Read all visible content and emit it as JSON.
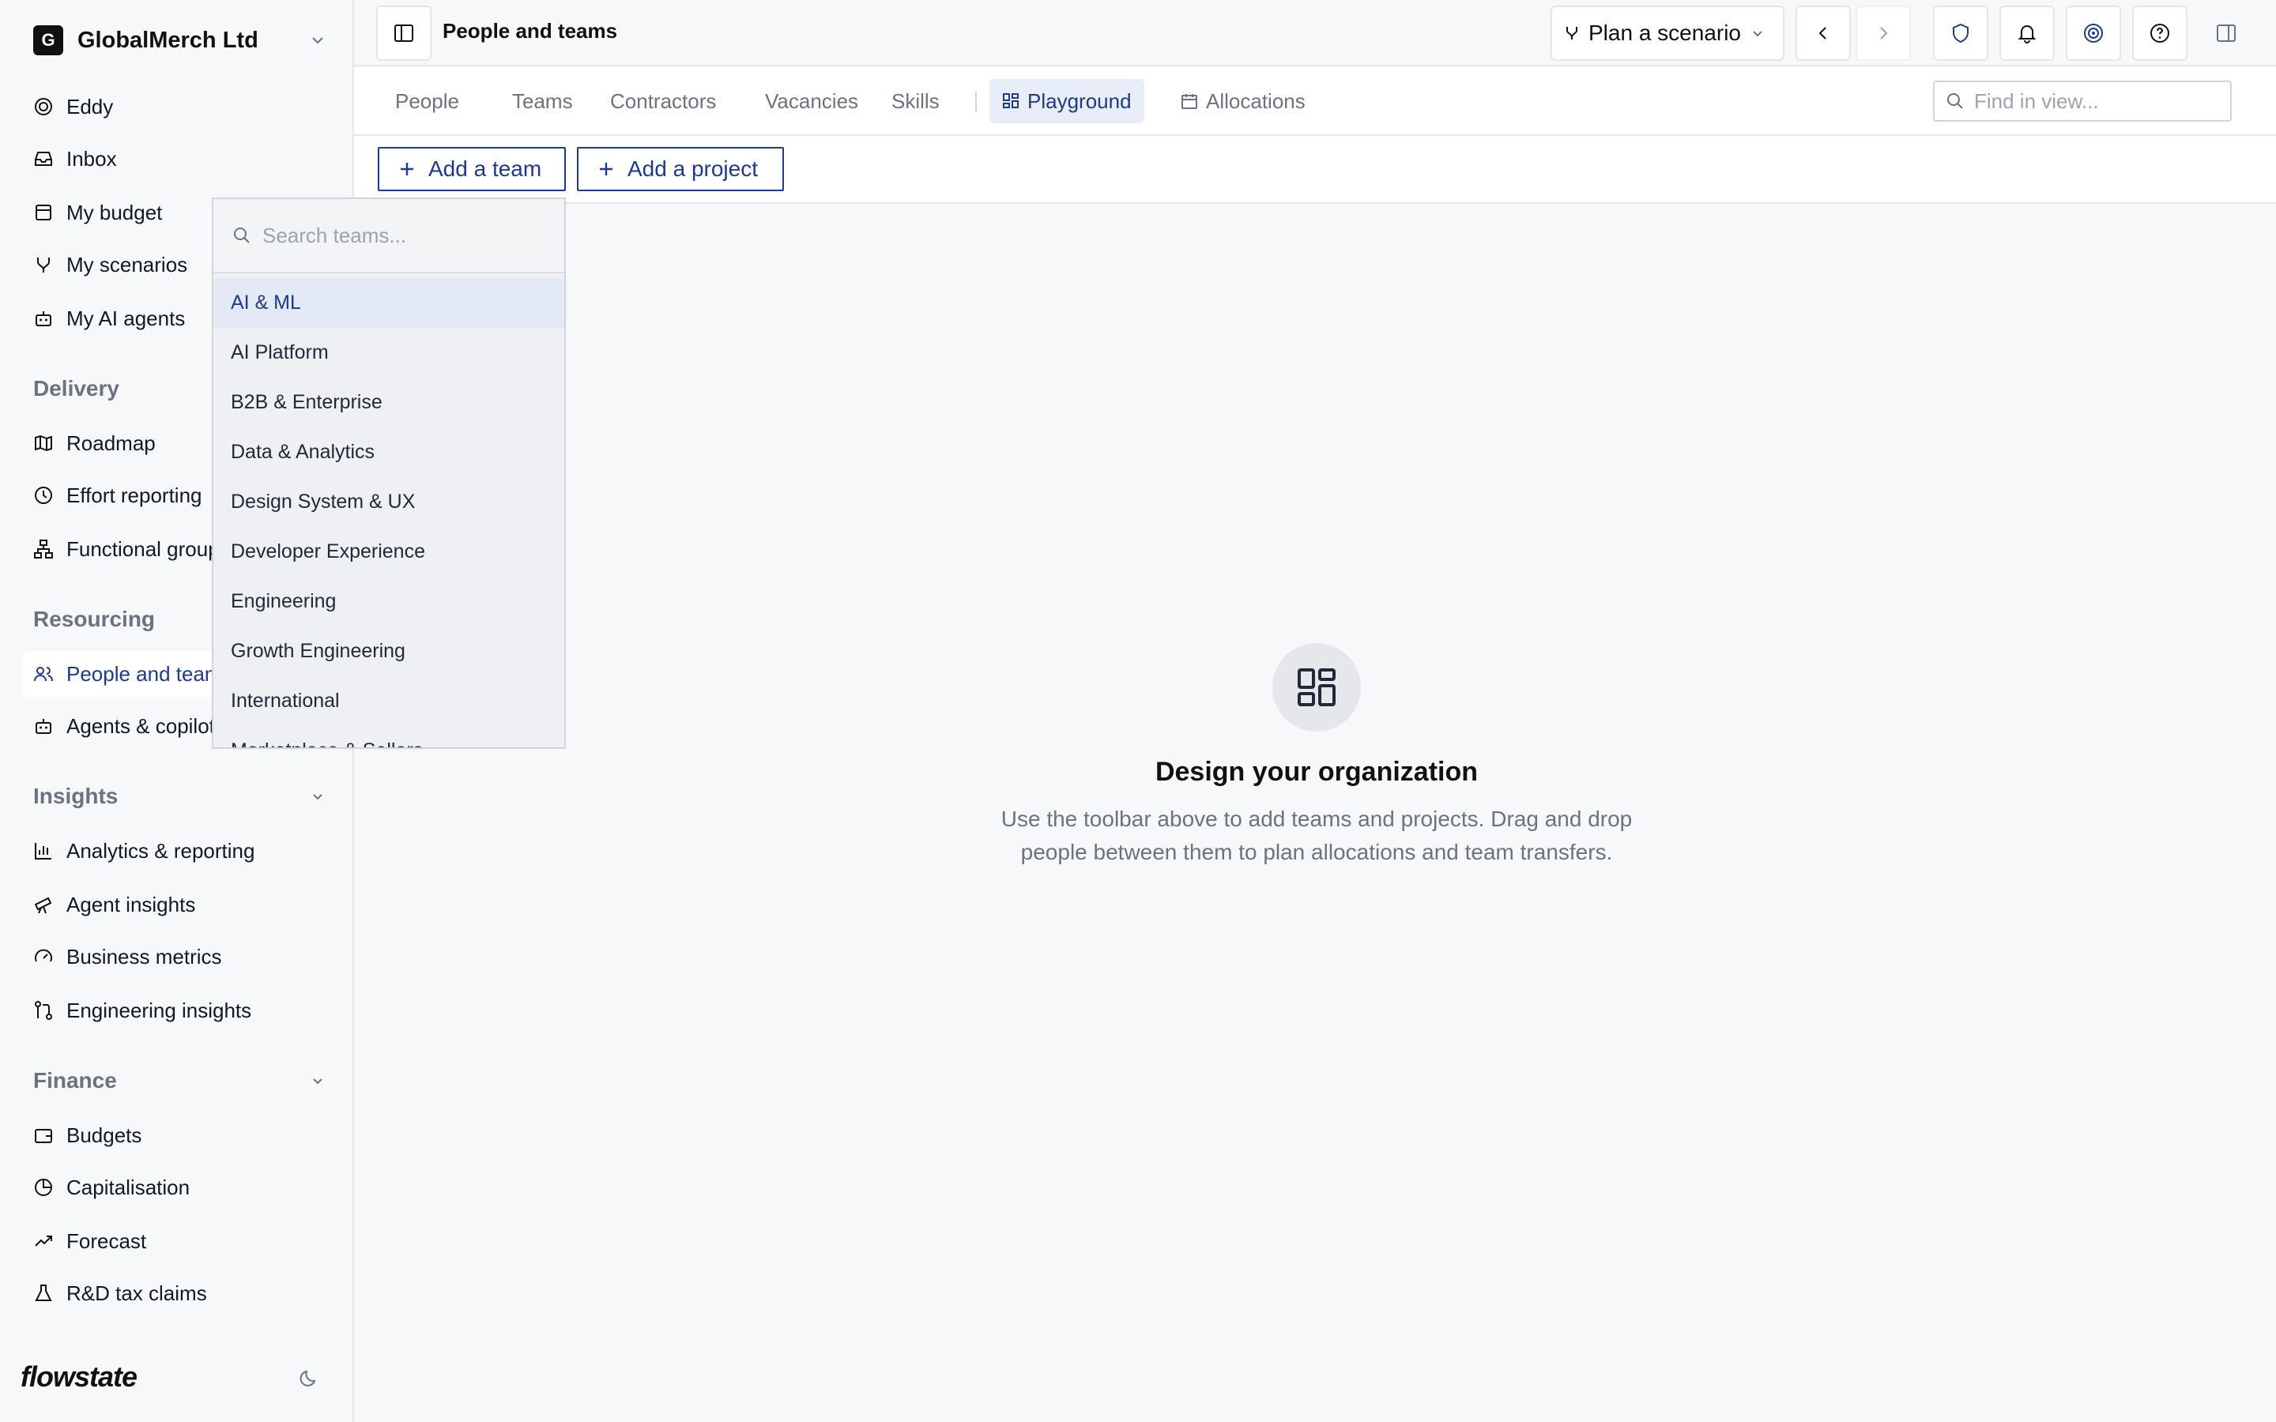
{
  "org": {
    "badge": "G",
    "name": "GlobalMerch Ltd"
  },
  "sidebar": {
    "top_items": [
      {
        "label": "Eddy",
        "icon": "eddy-spiral-icon"
      },
      {
        "label": "Inbox",
        "icon": "inbox-icon"
      },
      {
        "label": "My budget",
        "icon": "budget-icon"
      },
      {
        "label": "My scenarios",
        "icon": "scenario-branch-icon"
      },
      {
        "label": "My AI agents",
        "icon": "robot-icon"
      }
    ],
    "delivery": {
      "heading": "Delivery",
      "items": [
        {
          "label": "Roadmap",
          "icon": "map-icon"
        },
        {
          "label": "Effort reporting",
          "icon": "clock-icon"
        },
        {
          "label": "Functional groups",
          "icon": "hierarchy-icon"
        }
      ]
    },
    "resourcing": {
      "heading": "Resourcing",
      "items": [
        {
          "label": "People and teams",
          "icon": "people-icon",
          "active": true
        },
        {
          "label": "Agents & copilots",
          "icon": "robot-icon"
        }
      ]
    },
    "insights": {
      "heading": "Insights",
      "items": [
        {
          "label": "Analytics & reporting",
          "icon": "bar-chart-icon"
        },
        {
          "label": "Agent insights",
          "icon": "telescope-icon"
        },
        {
          "label": "Business metrics",
          "icon": "gauge-icon"
        },
        {
          "label": "Engineering insights",
          "icon": "git-compare-icon"
        }
      ]
    },
    "finance": {
      "heading": "Finance",
      "items": [
        {
          "label": "Budgets",
          "icon": "wallet-icon"
        },
        {
          "label": "Capitalisation",
          "icon": "pie-icon"
        },
        {
          "label": "Forecast",
          "icon": "trend-up-icon"
        },
        {
          "label": "R&D tax claims",
          "icon": "flask-icon"
        }
      ]
    },
    "brand": "flowstate"
  },
  "header": {
    "title": "People and teams",
    "plan_button": "Plan a scenario"
  },
  "tabs": [
    {
      "label": "People"
    },
    {
      "label": "Teams"
    },
    {
      "label": "Contractors"
    },
    {
      "label": "Vacancies"
    },
    {
      "label": "Skills"
    },
    {
      "label": "Playground",
      "active": true
    },
    {
      "label": "Allocations"
    }
  ],
  "find": {
    "placeholder": "Find in view..."
  },
  "toolbar": {
    "add_team": "Add a team",
    "add_project": "Add a project"
  },
  "empty_state": {
    "title": "Design your organization",
    "description": "Use the toolbar above to add teams and projects. Drag and drop people between them to plan allocations and team transfers."
  },
  "team_dropdown": {
    "placeholder": "Search teams...",
    "items": [
      "AI & ML",
      "AI Platform",
      "B2B & Enterprise",
      "Data & Analytics",
      "Design System & UX",
      "Developer Experience",
      "Engineering",
      "Growth Engineering",
      "International",
      "Marketplace & Sellers"
    ],
    "highlighted": "AI & ML"
  },
  "colors": {
    "accent": "#1e3a8a",
    "sidebar_bg": "#f7f8fa",
    "border": "#e5e7eb",
    "muted_text": "#6b7280"
  }
}
